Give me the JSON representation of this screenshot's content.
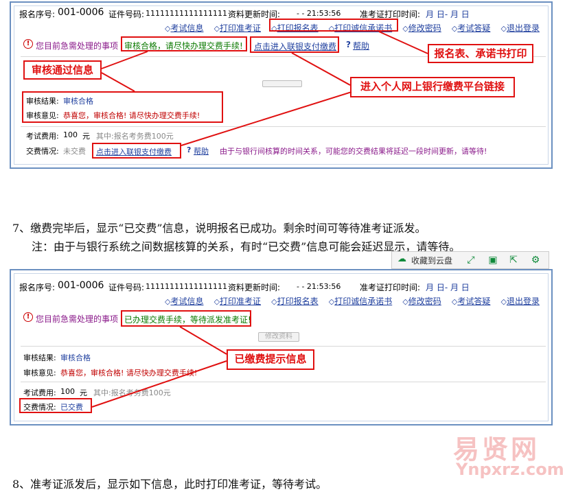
{
  "panel_top": {
    "reg_no_label": "报名序号:",
    "reg_no_value": "001-0006",
    "id_no_label": "证件号码:",
    "id_no_value": "11111111111111111",
    "update_time_label": "资料更新时间:",
    "update_time_value": "- -  21:53:56",
    "print_time_label": "准考证打印时间:",
    "print_time_value": "月   日- 月   日",
    "nav": [
      "考试信息",
      "打印准考证",
      "打印报名表",
      "打印诚信承诺书",
      "修改密码",
      "考试答疑",
      "退出登录"
    ],
    "pending_label": "您目前急需处理的事项",
    "pending_msg": "审核合格，请尽快办理交费手续!",
    "pay_link": "点击进入联银支付缴费",
    "help": "帮助",
    "audit_result_label": "审核结果:",
    "audit_result_value": "审核合格",
    "audit_opinion_label": "审核意见:",
    "audit_opinion_value": "恭喜您，审核合格! 请尽快办理交费手续!",
    "fee_label": "考试费用:",
    "fee_value": "100",
    "fee_unit": "元",
    "fee_detail": "其中:报名考务费100元",
    "pay_status_label": "交费情况:",
    "pay_status_value": "未交费",
    "pay_link2": "点击进入联银支付缴费",
    "help2": "帮助",
    "delay_note": "由于与银行间核算的时间关系，可能您的交费结果将延迟一段时间更新，请等待!"
  },
  "callouts_top": {
    "audit_pass": "审核通过信息",
    "bank_link": "进入个人网上银行缴费平台链接",
    "print_forms": "报名表、承诺书打印"
  },
  "step7": {
    "line1": "7、缴费完毕后，显示“已交费”信息，说明报名已成功。剩余时间可等待准考证派发。",
    "line2": "注：由于与银行系统之间数据核算的关系，有时“已交费”信息可能会延迟显示，请等待。"
  },
  "toolbar": {
    "save_cloud": "收藏到云盘"
  },
  "panel_bottom": {
    "reg_no_label": "报名序号:",
    "reg_no_value": "001-0006",
    "id_no_label": "证件号码:",
    "id_no_value": "11111111111111111",
    "update_time_label": "资料更新时间:",
    "update_time_value": "- -  21:53:56",
    "print_time_label": "准考证打印时间:",
    "print_time_value": "月   日- 月   日",
    "nav": [
      "考试信息",
      "打印准考证",
      "打印报名表",
      "打印诚信承诺书",
      "修改密码",
      "考试答疑",
      "退出登录"
    ],
    "pending_label": "您目前急需处理的事项",
    "pending_msg": "已办理交费手续，等待派发准考证!",
    "ghost_button": "修改资料",
    "audit_result_label": "审核结果:",
    "audit_result_value": "审核合格",
    "audit_opinion_label": "审核意见:",
    "audit_opinion_value": "恭喜您，审核合格! 请尽快办理交费手续!",
    "fee_label": "考试费用:",
    "fee_value": "100",
    "fee_unit": "元",
    "fee_detail": "其中:报名考务费100元",
    "pay_status_label": "交费情况:",
    "pay_status_value": "已交费"
  },
  "callouts_bottom": {
    "paid_hint": "已缴费提示信息"
  },
  "step8": {
    "line1": "8、准考证派发后，显示如下信息，此时打印准考证，等待考试。"
  },
  "watermark": {
    "cn": "易贤网",
    "en": "Ynpxrz.com"
  },
  "colors": {
    "annotation_red": "#e01010",
    "link_blue": "#1f3f9e",
    "frame_blue": "#6a8fc0"
  }
}
